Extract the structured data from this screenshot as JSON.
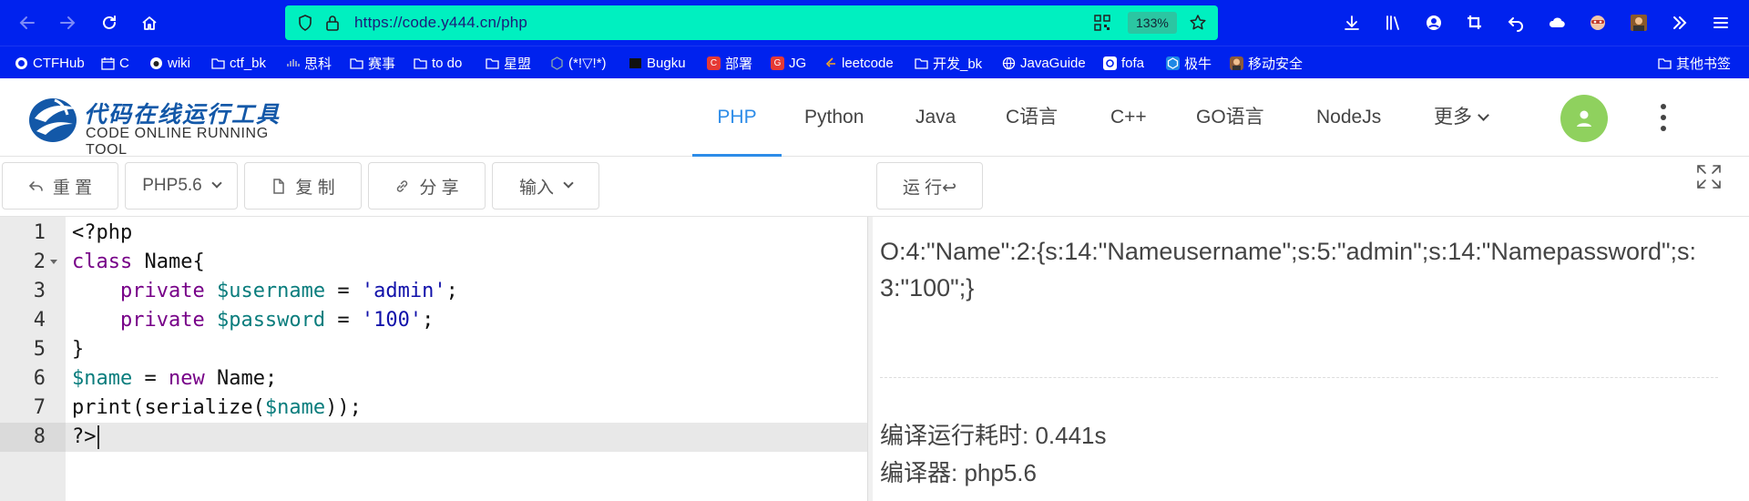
{
  "browser": {
    "url": "https://code.y444.cn/php",
    "zoom": "133%"
  },
  "bookmarks": [
    {
      "label": "CTFHub",
      "icon": "ctfhub-icon",
      "color": "#ffffff"
    },
    {
      "label": "C",
      "icon": "folder-calendar-icon",
      "color": "#ffffff"
    },
    {
      "label": "wiki",
      "icon": "wiki-icon",
      "color": "#ffffff"
    },
    {
      "label": "ctf_bk",
      "icon": "folder-icon",
      "color": "#ffffff"
    },
    {
      "label": "思科",
      "icon": "cisco-icon",
      "color": "#ffffff"
    },
    {
      "label": "赛事",
      "icon": "folder-icon",
      "color": "#ffffff"
    },
    {
      "label": "to do",
      "icon": "folder-icon",
      "color": "#ffffff"
    },
    {
      "label": "星盟",
      "icon": "folder-icon",
      "color": "#ffffff"
    },
    {
      "label": "(*!▽!*)",
      "icon": "hex-icon",
      "color": "#ffffff"
    },
    {
      "label": "Bugku",
      "icon": "bugku-icon",
      "color": "#ffffff"
    },
    {
      "label": "部署",
      "icon": "c-red-icon",
      "color": "#ffffff"
    },
    {
      "label": "JG",
      "icon": "g-red-icon",
      "color": "#ffffff"
    },
    {
      "label": "leetcode",
      "icon": "leetcode-icon",
      "color": "#ffffff"
    },
    {
      "label": "开发_bk",
      "icon": "folder-icon",
      "color": "#ffffff"
    },
    {
      "label": "JavaGuide",
      "icon": "globe-icon",
      "color": "#ffffff"
    },
    {
      "label": "fofa",
      "icon": "fofa-icon",
      "color": "#ffffff"
    },
    {
      "label": "极牛",
      "icon": "jiniu-icon",
      "color": "#ffffff"
    },
    {
      "label": "移动安全",
      "icon": "mobile-sec-icon",
      "color": "#ffffff"
    }
  ],
  "other_bookmarks": "其他书签",
  "site": {
    "logo_cn": "代码在线运行工具",
    "logo_en": "CODE ONLINE RUNNING TOOL",
    "nav": [
      "PHP",
      "Python",
      "Java",
      "C语言",
      "C++",
      "GO语言",
      "NodeJs",
      "更多"
    ],
    "active_nav": "PHP",
    "accent_color": "#2d8ce8"
  },
  "toolbar": {
    "reset": "重 置",
    "version": "PHP5.6",
    "copy": "复 制",
    "share": "分 享",
    "input": "输入",
    "run": "运 行↩"
  },
  "editor": {
    "lines": [
      {
        "num": "1",
        "code": "<?php"
      },
      {
        "num": "2",
        "code": "class Name{"
      },
      {
        "num": "3",
        "code": "    private $username = 'admin';"
      },
      {
        "num": "4",
        "code": "    private $password = '100';"
      },
      {
        "num": "5",
        "code": "}"
      },
      {
        "num": "6",
        "code": "$name = new Name;"
      },
      {
        "num": "7",
        "code": "print(serialize($name));"
      },
      {
        "num": "8",
        "code": "?>"
      }
    ],
    "active_line": "8"
  },
  "output": {
    "result": "O:4:\"Name\":2:{s:14:\"Nameusername\";s:5:\"admin\";s:14:\"Namepassword\";s:3:\"100\";}",
    "time_label": "编译运行耗时: 0.441s",
    "compiler_label": "编译器: php5.6"
  }
}
